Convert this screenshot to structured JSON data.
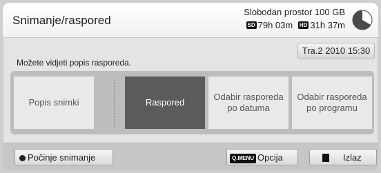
{
  "header": {
    "title": "Snimanje/raspored",
    "free_space": "Slobodan prostor 100 GB",
    "sd_badge": "SD",
    "sd_time": "79h 03m",
    "hd_badge": "HD",
    "hd_time": "31h 37m",
    "pie_icon": "storage-pie-icon"
  },
  "date": "Tra.2 2010 15:30",
  "description": "Možete vidjeti popis rasporeda.",
  "menu": {
    "items": [
      {
        "label": "Popis snimki"
      },
      {
        "label": "Raspored"
      },
      {
        "label": "Odabir rasporeda po datuma"
      },
      {
        "label": "Odabir rasporeda po programu"
      }
    ],
    "selected": "Raspored"
  },
  "footer": {
    "record_label": "Počinje snimanje",
    "qmenu_key": "Q.MENU",
    "option_label": "Opcija",
    "exit_label": "Izlaz"
  },
  "colors": {
    "selected_tile": "#5b5b5b",
    "tile": "#e9e9e9",
    "menu_bg": "#bdbdbd"
  }
}
